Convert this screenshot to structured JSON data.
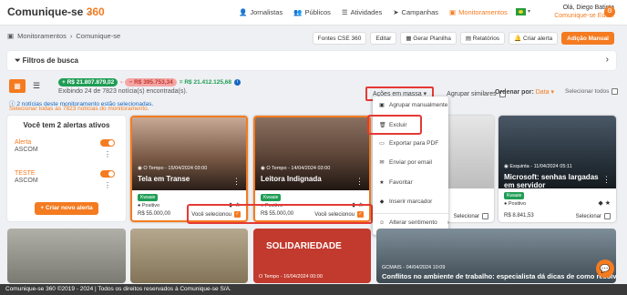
{
  "header": {
    "logo_text": "Comunique-se",
    "logo_num": "360",
    "nav": [
      {
        "icon": "person-icon",
        "label": "Jornalistas"
      },
      {
        "icon": "people-icon",
        "label": "Públicos"
      },
      {
        "icon": "list-icon",
        "label": "Atividades"
      },
      {
        "icon": "send-icon",
        "label": "Campanhas"
      },
      {
        "icon": "monitor-icon",
        "label": "Monitoramentos"
      }
    ],
    "user_greeting": "Olá, Diego Batista",
    "user_company": "Comunique-se Edu..."
  },
  "breadcrumb": {
    "root": "Monitoramentos",
    "current": "Comunique-se"
  },
  "toolbar": {
    "fontes": "Fontes CSE 360",
    "editar": "Editar",
    "gerar": "Gerar Planilha",
    "relatorios": "Relatórios",
    "criar_alerta": "Criar alerta",
    "adicao": "Adição Manual"
  },
  "filters": {
    "label": "Filtros de busca"
  },
  "stats": {
    "pos": "R$ 21.807.879,02",
    "neg": "R$ 395.753,34",
    "total": "R$ 21.412.125,68",
    "showing": "Exibindo 24 de 7823 notícia(s) encontrada(s)."
  },
  "mass": {
    "label": "Ações em massa",
    "similar": "Agrupar similares",
    "order_label": "Ordenar por:",
    "order_value": "Data",
    "select_all": "Selecionar todos"
  },
  "notices": {
    "line1": "2 notícias deste monitoramento estão selecionadas.",
    "line2": "Selecionar todas as 7823 notícias do monitoramento."
  },
  "alerts": {
    "title": "Você tem 2 alertas ativos",
    "items": [
      {
        "name": "Alerta",
        "sub": "ASCOM"
      },
      {
        "name": "TESTE",
        "sub": "ASCOM"
      }
    ],
    "new_label": "Criar novo alerta"
  },
  "cards": [
    {
      "meta": "O Tempo - 15/04/2024 03:00",
      "title": "Tela em Transe",
      "tag": "Kwaaie",
      "sentiment": "Positivo",
      "value": "R$ 55.000,00",
      "selected": "Você selecionou"
    },
    {
      "meta": "O Tempo - 14/04/2024 03:00",
      "title": "Leitora Indignada",
      "tag": "Kwaaie",
      "sentiment": "Positivo",
      "value": "R$ 55.000,00",
      "selected": "Você selecionou"
    },
    {
      "meta": "",
      "title": "",
      "tag": "",
      "sentiment": "",
      "value": "",
      "selected": "Selecionar"
    },
    {
      "meta": "Esquinta - 11/04/2024 05:11",
      "title": "Microsoft: senhas largadas em servidor",
      "tag": "Kwaaie",
      "sentiment": "Positivo",
      "value": "R$ 8.841,53",
      "selected": "Selecionar"
    }
  ],
  "menu": {
    "items": [
      {
        "icon": "group-icon",
        "label": "Agrupar manualmente"
      },
      {
        "icon": "trash-icon",
        "label": "Excluir"
      },
      {
        "icon": "file-icon",
        "label": "Exportar para PDF"
      },
      {
        "icon": "mail-icon",
        "label": "Enviar por email"
      },
      {
        "icon": "star-icon",
        "label": "Favoritar"
      },
      {
        "icon": "bookmark-icon",
        "label": "Inserir marcador"
      },
      {
        "icon": "smile-icon",
        "label": "Alterar sentimento"
      }
    ]
  },
  "bottom": {
    "meta": "GCMAIS - 04/04/2024 10:09",
    "title": "Conflitos no ambiente de trabalho: especialista dá dicas de como resolver",
    "badge_text": "SOLIDARIEDADE",
    "badge_meta": "O Tempo - 16/04/2024 00:00"
  },
  "footer": {
    "text": "Comunique-se 360 ©2019 - 2024 | Todos os direitos reservados à Comunique-se S/A."
  },
  "colors": {
    "accent": "#f47b20",
    "positive": "#1f9d55",
    "negative": "#e53935"
  }
}
